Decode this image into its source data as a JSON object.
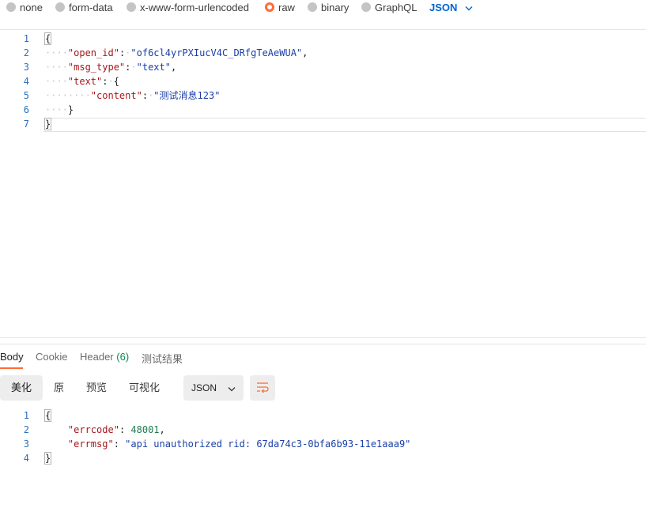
{
  "body_types": [
    {
      "label": "none",
      "selected": false
    },
    {
      "label": "form-data",
      "selected": false
    },
    {
      "label": "x-www-form-urlencoded",
      "selected": false
    },
    {
      "label": "raw",
      "selected": true
    },
    {
      "label": "binary",
      "selected": false
    },
    {
      "label": "GraphQL",
      "selected": false
    }
  ],
  "language_select": {
    "value": "JSON",
    "icon": "chevron-down-icon"
  },
  "request_editor": {
    "line_numbers": [
      "1",
      "2",
      "3",
      "4",
      "5",
      "6",
      "7"
    ],
    "open_brace": "{",
    "close_brace": "}",
    "open_id_key": "\"open_id\"",
    "open_id_value": "\"of6cl4yrPXIucV4C_DRfgTeAeWUA\"",
    "msg_type_key": "\"msg_type\"",
    "msg_type_value": "\"text\"",
    "text_key": "\"text\"",
    "content_key": "\"content\"",
    "content_value": "\"测试消息123\""
  },
  "response_tabs": {
    "body": "Body",
    "cookie": "Cookie",
    "header": "Header",
    "header_count": "(6)",
    "test_results": "测试结果"
  },
  "view_modes": {
    "pretty": "美化",
    "raw": "原",
    "preview": "预览",
    "visualize": "可视化"
  },
  "format_select": {
    "value": "JSON",
    "icon": "chevron-down-icon"
  },
  "wrap_button": {
    "icon": "wrap-lines-icon"
  },
  "response_editor": {
    "line_numbers": [
      "1",
      "2",
      "3",
      "4"
    ],
    "open_brace": "{",
    "close_brace": "}",
    "errcode_key": "\"errcode\"",
    "errcode_value": "48001",
    "errmsg_key": "\"errmsg\"",
    "errmsg_value": "\"api unauthorized rid: 67da74c3-0bfa6b93-11e1aaa9\""
  },
  "colors": {
    "accent": "#ff6c37",
    "link_blue": "#0265d2",
    "json_key": "#a8151c",
    "json_string": "#1a3fa8",
    "json_number": "#1d7a52",
    "count_green": "#0f8a4f"
  }
}
